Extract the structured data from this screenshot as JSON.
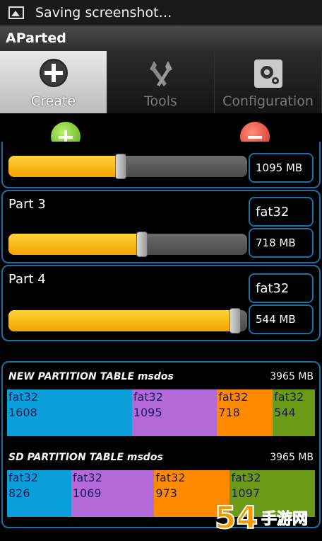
{
  "status_bar": {
    "text": "Saving screenshot…",
    "icon": "image-icon"
  },
  "title_bar": {
    "title": "AParted"
  },
  "tabs": [
    {
      "label": "Create",
      "icon": "plus-circle-icon",
      "active": true
    },
    {
      "label": "Tools",
      "icon": "wrench-icon",
      "active": false
    },
    {
      "label": "Configuration",
      "icon": "gear-icon",
      "active": false
    }
  ],
  "actions": {
    "add_symbol": "+",
    "remove_symbol": "−"
  },
  "partitions": [
    {
      "name": "",
      "fs": "",
      "size": "1095 MB",
      "level": 0.47
    },
    {
      "name": "Part 3",
      "fs": "fat32",
      "size": "718 MB",
      "level": 0.56
    },
    {
      "name": "Part 4",
      "fs": "fat32",
      "size": "544 MB",
      "level": 0.95
    }
  ],
  "new_table": {
    "title": "NEW PARTITION TABLE msdos",
    "total": "3965 MB",
    "segments": [
      {
        "fs": "fat32",
        "size": "1608",
        "color": "#0a9fd9"
      },
      {
        "fs": "fat32",
        "size": "1095",
        "color": "#b36ad9"
      },
      {
        "fs": "fat32",
        "size": "718",
        "color": "#ff8a00"
      },
      {
        "fs": "fat32",
        "size": "544",
        "color": "#6a9a18"
      }
    ]
  },
  "sd_table": {
    "title": "SD PARTITION TABLE msdos",
    "total": "3965 MB",
    "segments": [
      {
        "fs": "fat32",
        "size": "826",
        "color": "#0a9fd9"
      },
      {
        "fs": "fat32",
        "size": "1069",
        "color": "#b36ad9"
      },
      {
        "fs": "fat32",
        "size": "973",
        "color": "#ff8a00"
      },
      {
        "fs": "fat32",
        "size": "1097",
        "color": "#6a9a18"
      }
    ]
  },
  "watermark": {
    "text": "54 手游网",
    "url": "54.com"
  }
}
